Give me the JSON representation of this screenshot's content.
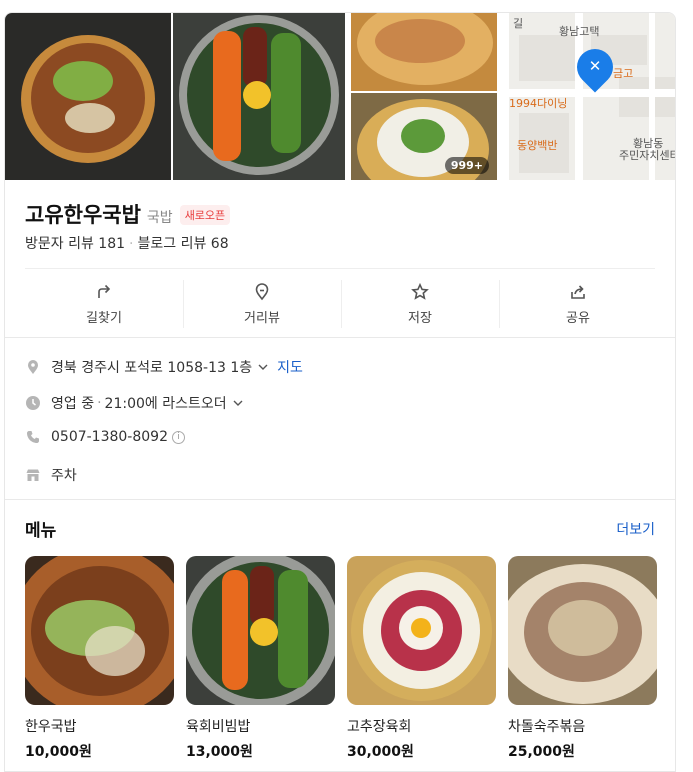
{
  "photos": {
    "count_badge": "999+"
  },
  "map": {
    "labels": [
      {
        "text": "황남고택"
      },
      {
        "text": "금고"
      },
      {
        "text": "1994다이닝"
      },
      {
        "text": "동양백반"
      },
      {
        "text": "황남동"
      },
      {
        "text": "주민자치센터"
      },
      {
        "text": "길"
      }
    ]
  },
  "place": {
    "name": "고유한우국밥",
    "category": "국밥",
    "badge": "새로오픈",
    "visitor_reviews": "방문자 리뷰 181",
    "blog_reviews": "블로그 리뷰 68"
  },
  "actions": [
    {
      "label": "길찾기",
      "icon": "directions-icon"
    },
    {
      "label": "거리뷰",
      "icon": "street-view-icon"
    },
    {
      "label": "저장",
      "icon": "star-icon"
    },
    {
      "label": "공유",
      "icon": "share-icon"
    }
  ],
  "info": {
    "address": "경북 경주시 포석로 1058-13 1층",
    "map_link": "지도",
    "status": "영업 중",
    "last_order": "21:00에 라스트오더",
    "phone": "0507-1380-8092",
    "parking": "주차"
  },
  "menu": {
    "title": "메뉴",
    "more": "더보기",
    "items": [
      {
        "name": "한우국밥",
        "price": "10,000원"
      },
      {
        "name": "육회비빔밥",
        "price": "13,000원"
      },
      {
        "name": "고추장육회",
        "price": "30,000원"
      },
      {
        "name": "차돌숙주볶음",
        "price": "25,000원"
      }
    ]
  },
  "colors": {
    "accent_link": "#1a5fc9",
    "badge_red": "#e83b3b",
    "map_pin": "#1a7de8"
  }
}
